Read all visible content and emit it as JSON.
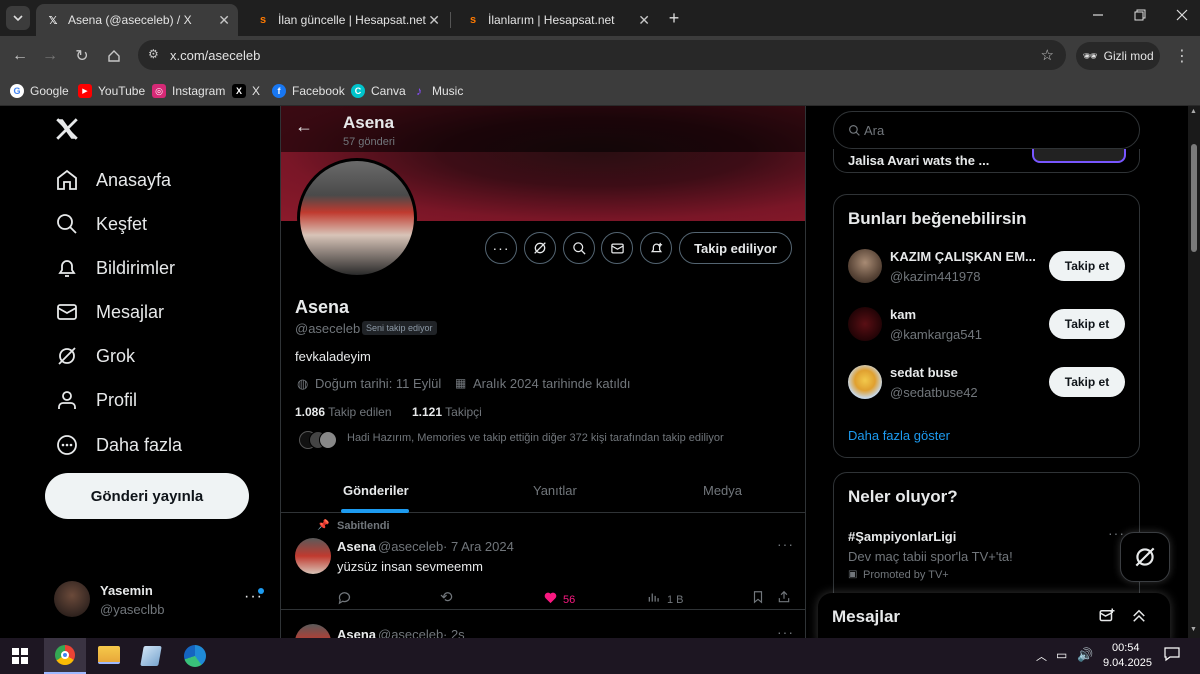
{
  "browser": {
    "tabs": [
      {
        "title": "Asena (@aseceleb) / X",
        "icon": "x-logo-icon",
        "active": true
      },
      {
        "title": "İlan güncelle | Hesapsat.net",
        "icon": "hesapsat-icon",
        "active": false
      },
      {
        "title": "İlanlarım | Hesapsat.net",
        "icon": "hesapsat-icon",
        "active": false
      }
    ],
    "url": "x.com/aseceleb",
    "incognito_label": "Gizli mod",
    "bookmarks": [
      {
        "label": "Google",
        "color": "#4285f4",
        "glyph": "G"
      },
      {
        "label": "YouTube",
        "color": "#ff0000",
        "glyph": "▶"
      },
      {
        "label": "Instagram",
        "color": "#d62976",
        "glyph": "◎"
      },
      {
        "label": "X",
        "color": "#000000",
        "glyph": "X"
      },
      {
        "label": "Facebook",
        "color": "#1877f2",
        "glyph": "f"
      },
      {
        "label": "Canva",
        "color": "#00c4cc",
        "glyph": "C"
      },
      {
        "label": "Music",
        "color": "#8a4fff",
        "glyph": "♪"
      }
    ]
  },
  "sidebar": {
    "items": [
      {
        "label": "Anasayfa",
        "icon": "home-icon"
      },
      {
        "label": "Keşfet",
        "icon": "search-icon"
      },
      {
        "label": "Bildirimler",
        "icon": "bell-icon"
      },
      {
        "label": "Mesajlar",
        "icon": "mail-icon"
      },
      {
        "label": "Grok",
        "icon": "grok-icon"
      },
      {
        "label": "Profil",
        "icon": "person-icon"
      },
      {
        "label": "Daha fazla",
        "icon": "more-circle-icon"
      }
    ],
    "post_button": "Gönderi yayınla",
    "account": {
      "name": "Yasemin",
      "handle": "@yaseclbb"
    }
  },
  "profile": {
    "header_name": "Asena",
    "post_count": "57 gönderi",
    "name": "Asena",
    "handle": "@aseceleb",
    "follows_you": "Seni takip ediyor",
    "bio": "fevkaladeyim",
    "birthday": "Doğum tarihi: 11 Eylül",
    "joined": "Aralık 2024 tarihinde katıldı",
    "following_count": "1.086",
    "following_label": "Takip edilen",
    "followers_count": "1.121",
    "followers_label": "Takipçi",
    "followed_by": "Hadi Hazırım, Memories ve takip ettiğin diğer 372 kişi tarafından takip ediliyor",
    "following_button": "Takip ediliyor",
    "tabs": [
      "Gönderiler",
      "Yanıtlar",
      "Medya"
    ]
  },
  "posts": [
    {
      "pinned_label": "Sabitlendi",
      "name": "Asena",
      "handle": "@aseceleb",
      "time": "· 7 Ara 2024",
      "text": "yüzsüz insan sevmeemm",
      "likes": "56",
      "views": "1 B"
    },
    {
      "name": "Asena",
      "handle": "@aseceleb",
      "time": "· 2s"
    }
  ],
  "right": {
    "search_placeholder": "Ara",
    "top_trend_text": "Jalisa Avari wats the ...",
    "suggest_title": "Bunları beğenebilirsin",
    "suggestions": [
      {
        "name": "KAZIM ÇALIŞKAN EM...",
        "handle": "@kazim441978",
        "button": "Takip et"
      },
      {
        "name": "kam",
        "handle": "@kamkarga541",
        "button": "Takip et"
      },
      {
        "name": "sedat buse",
        "handle": "@sedatbuse42",
        "button": "Takip et"
      }
    ],
    "show_more": "Daha fazla göster",
    "trends_title": "Neler oluyor?",
    "trend": {
      "tag": "#ŞampiyonlarLigi",
      "desc": "Dev maç tabii spor'la TV+'ta!",
      "promoted": "Promoted by TV+"
    },
    "messages_title": "Mesajlar"
  },
  "taskbar": {
    "time": "00:54",
    "date": "9.04.2025"
  },
  "colors": {
    "accent": "#1d9bf0",
    "like": "#f91880",
    "banner": "#8b1a2b"
  }
}
